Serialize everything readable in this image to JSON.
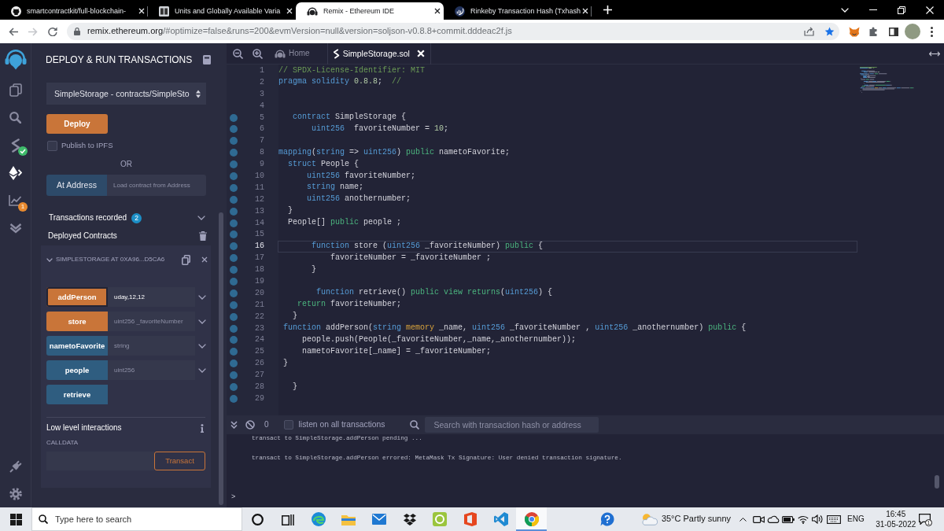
{
  "browser": {
    "tabs": [
      {
        "kind": "cat",
        "title": "smartcontractkit/full-blockchain-",
        "selected": false
      },
      {
        "kind": "book",
        "title": "Units and Globally Available Varia",
        "selected": false
      },
      {
        "kind": "headset",
        "title": "Remix - Ethereum IDE",
        "selected": true
      },
      {
        "kind": "globe",
        "title": "Rinkeby Transaction Hash (Txhash",
        "selected": false
      }
    ],
    "toolbar": {
      "back_disabled": false,
      "forward_disabled": true,
      "host": "remix.ethereum.org",
      "path": "/#optimize=false&runs=200&evmVersion=null&version=soljson-v0.8.8+commit.dddeac2f.js",
      "bookmarked": true
    }
  },
  "icon_panel": {
    "top": [
      {
        "kind": "logo",
        "selected": false
      },
      {
        "kind": "files",
        "selected": false
      },
      {
        "kind": "search",
        "selected": false
      },
      {
        "kind": "compiler",
        "selected": false,
        "badge": {
          "kind": "check"
        }
      },
      {
        "kind": "deploy",
        "selected": true
      },
      {
        "kind": "analysis",
        "selected": false,
        "badge": {
          "kind": "count",
          "text": "1"
        }
      },
      {
        "kind": "tests",
        "selected": false
      }
    ],
    "bottom": [
      {
        "kind": "plugins",
        "selected": false
      },
      {
        "kind": "settings",
        "selected": false
      }
    ]
  },
  "side_panel": {
    "title": "DEPLOY & RUN TRANSACTIONS",
    "contract": "SimpleStorage - contracts/SimpleSto",
    "deploy": "Deploy",
    "publish": {
      "label": "Publish to IPFS",
      "checked": false
    },
    "or": "OR",
    "at_address": {
      "label": "At Address",
      "placeholder": "Load contract from Address"
    },
    "transactions": {
      "label": "Transactions recorded",
      "count": "2"
    },
    "deployed": {
      "title": "Deployed Contracts",
      "instances": [
        {
          "title": "SIMPLESTORAGE AT 0XA96...D5CA6",
          "expanded": true,
          "functions": [
            {
              "name": "addPerson",
              "kind": "transact",
              "value": "uday,12,12",
              "focused": true
            },
            {
              "name": "store",
              "kind": "transact",
              "placeholder": "uint256 _favoriteNumber",
              "focused": false
            },
            {
              "name": "nametoFavorite",
              "kind": "call",
              "placeholder": "string",
              "focused": false
            },
            {
              "name": "people",
              "kind": "call",
              "placeholder": "uint256",
              "focused": false
            },
            {
              "name": "retrieve",
              "kind": "call",
              "focused": false
            }
          ],
          "low_level": {
            "title": "Low level interactions",
            "calldata": "CALLDATA",
            "button": "Transact"
          }
        }
      ]
    }
  },
  "editor": {
    "tabs": [
      {
        "kind": "home",
        "title": "Home",
        "selected": false,
        "closable": false
      },
      {
        "kind": "file",
        "title": "SimpleStorage.sol",
        "selected": true,
        "closable": true
      }
    ],
    "lines": [
      {
        "number": "1",
        "marked": false,
        "current": false,
        "tokens": [
          {
            "text": "// SPDX-License-Identifier: MIT",
            "kind": "comment"
          }
        ]
      },
      {
        "number": "2",
        "marked": false,
        "current": false,
        "tokens": [
          {
            "text": "pragma solidity ",
            "kind": "keyword"
          },
          {
            "text": "0.8.8",
            "kind": "number"
          },
          {
            "text": ";  ",
            "kind": "plain"
          },
          {
            "text": "//",
            "kind": "comment"
          }
        ]
      },
      {
        "number": "3",
        "marked": false,
        "current": false
      },
      {
        "number": "4",
        "marked": false,
        "current": false
      },
      {
        "number": "5",
        "marked": true,
        "current": false,
        "tokens": [
          {
            "text": "   contract ",
            "kind": "keyword"
          },
          {
            "text": "SimpleStorage {",
            "kind": "plain"
          }
        ]
      },
      {
        "number": "6",
        "marked": true,
        "current": false,
        "tokens": [
          {
            "text": "       uint256",
            "kind": "type"
          },
          {
            "text": "  favoriteNumber = ",
            "kind": "plain"
          },
          {
            "text": "10",
            "kind": "number"
          },
          {
            "text": ";",
            "kind": "plain"
          }
        ]
      },
      {
        "number": "7",
        "marked": true,
        "current": false
      },
      {
        "number": "8",
        "marked": true,
        "current": false,
        "tokens": [
          {
            "text": "mapping",
            "kind": "keyword"
          },
          {
            "text": "(",
            "kind": "plain"
          },
          {
            "text": "string",
            "kind": "type"
          },
          {
            "text": " => ",
            "kind": "plain"
          },
          {
            "text": "uint256",
            "kind": "type"
          },
          {
            "text": ") ",
            "kind": "plain"
          },
          {
            "text": "public",
            "kind": "modifier"
          },
          {
            "text": " nametoFavorite;",
            "kind": "plain"
          }
        ]
      },
      {
        "number": "9",
        "marked": true,
        "current": false,
        "tokens": [
          {
            "text": "  struct ",
            "kind": "keyword"
          },
          {
            "text": "People {",
            "kind": "plain"
          }
        ]
      },
      {
        "number": "10",
        "marked": true,
        "current": false,
        "tokens": [
          {
            "text": "      uint256",
            "kind": "type"
          },
          {
            "text": " favoriteNumber;",
            "kind": "plain"
          }
        ]
      },
      {
        "number": "11",
        "marked": true,
        "current": false,
        "tokens": [
          {
            "text": "      string",
            "kind": "type"
          },
          {
            "text": " name;",
            "kind": "plain"
          }
        ]
      },
      {
        "number": "12",
        "marked": true,
        "current": false,
        "tokens": [
          {
            "text": "      uint256",
            "kind": "type"
          },
          {
            "text": " anothernumber;",
            "kind": "plain"
          }
        ]
      },
      {
        "number": "13",
        "marked": true,
        "current": false,
        "tokens": [
          {
            "text": "  }",
            "kind": "plain"
          }
        ]
      },
      {
        "number": "14",
        "marked": true,
        "current": false,
        "tokens": [
          {
            "text": "  People[] ",
            "kind": "plain"
          },
          {
            "text": "public",
            "kind": "modifier"
          },
          {
            "text": " people ;",
            "kind": "plain"
          }
        ]
      },
      {
        "number": "15",
        "marked": true,
        "current": false
      },
      {
        "number": "16",
        "marked": true,
        "current": true,
        "tokens": [
          {
            "text": "       function ",
            "kind": "keyword"
          },
          {
            "text": "store (",
            "kind": "plain"
          },
          {
            "text": "uint256",
            "kind": "type"
          },
          {
            "text": " _favoriteNumber) ",
            "kind": "plain"
          },
          {
            "text": "public",
            "kind": "modifier"
          },
          {
            "text": " {",
            "kind": "plain"
          }
        ]
      },
      {
        "number": "17",
        "marked": true,
        "current": false,
        "tokens": [
          {
            "text": "           favoriteNumber = _favoriteNumber ;",
            "kind": "plain"
          }
        ]
      },
      {
        "number": "18",
        "marked": true,
        "current": false,
        "tokens": [
          {
            "text": "       }",
            "kind": "plain"
          }
        ]
      },
      {
        "number": "19",
        "marked": true,
        "current": false
      },
      {
        "number": "20",
        "marked": true,
        "current": false,
        "tokens": [
          {
            "text": "        function ",
            "kind": "keyword"
          },
          {
            "text": "retrieve() ",
            "kind": "plain"
          },
          {
            "text": "public view returns",
            "kind": "modifier"
          },
          {
            "text": "(",
            "kind": "plain"
          },
          {
            "text": "uint256",
            "kind": "type"
          },
          {
            "text": ") {",
            "kind": "plain"
          }
        ]
      },
      {
        "number": "21",
        "marked": true,
        "current": false,
        "tokens": [
          {
            "text": "    return",
            "kind": "modifier"
          },
          {
            "text": " favoriteNumber;",
            "kind": "plain"
          }
        ]
      },
      {
        "number": "22",
        "marked": true,
        "current": false,
        "tokens": [
          {
            "text": "   }",
            "kind": "plain"
          }
        ]
      },
      {
        "number": "23",
        "marked": true,
        "current": false,
        "tokens": [
          {
            "text": " function ",
            "kind": "keyword"
          },
          {
            "text": "addPerson(",
            "kind": "plain"
          },
          {
            "text": "string ",
            "kind": "type"
          },
          {
            "text": "memory",
            "kind": "storage"
          },
          {
            "text": " _name, ",
            "kind": "plain"
          },
          {
            "text": "uint256",
            "kind": "type"
          },
          {
            "text": " _favoriteNumber , ",
            "kind": "plain"
          },
          {
            "text": "uint256",
            "kind": "type"
          },
          {
            "text": " _anothernumber) ",
            "kind": "plain"
          },
          {
            "text": "public",
            "kind": "modifier"
          },
          {
            "text": " {",
            "kind": "plain"
          }
        ]
      },
      {
        "number": "24",
        "marked": true,
        "current": false,
        "tokens": [
          {
            "text": "     people.push(People(_favoriteNumber,_name,_anothernumber));",
            "kind": "plain"
          }
        ]
      },
      {
        "number": "25",
        "marked": true,
        "current": false,
        "tokens": [
          {
            "text": "     nametoFavorite[_name] = _favoriteNumber;",
            "kind": "plain"
          }
        ]
      },
      {
        "number": "26",
        "marked": true,
        "current": false,
        "tokens": [
          {
            "text": " }",
            "kind": "plain"
          }
        ]
      },
      {
        "number": "27",
        "marked": true,
        "current": false
      },
      {
        "number": "28",
        "marked": true,
        "current": false,
        "tokens": [
          {
            "text": "   }",
            "kind": "plain"
          }
        ]
      },
      {
        "number": "29",
        "marked": true,
        "current": false
      }
    ]
  },
  "terminal": {
    "count": "0",
    "listen": {
      "label": "listen on all transactions",
      "checked": false
    },
    "search_placeholder": "Search with transaction hash or address",
    "log": [
      "transact to SimpleStorage.addPerson pending ...",
      "transact to SimpleStorage.addPerson errored: MetaMask Tx Signature: User denied transaction signature."
    ],
    "prompt": ">"
  },
  "taskbar": {
    "search_placeholder": "Type here to search",
    "apps": [
      {
        "kind": "cortana",
        "selected": false
      },
      {
        "kind": "taskview",
        "selected": false
      },
      {
        "kind": "edge",
        "selected": false
      },
      {
        "kind": "explorer",
        "selected": false
      },
      {
        "kind": "mail",
        "selected": false
      },
      {
        "kind": "dropbox",
        "selected": false
      },
      {
        "kind": "android",
        "selected": false
      },
      {
        "kind": "office",
        "selected": false
      },
      {
        "kind": "vscode",
        "selected": false
      },
      {
        "kind": "chrome",
        "selected": true
      }
    ],
    "weather": "35°C Partly sunny",
    "language": "ENG",
    "time": "16:45",
    "date": "31-05-2022",
    "notifications": "1"
  }
}
